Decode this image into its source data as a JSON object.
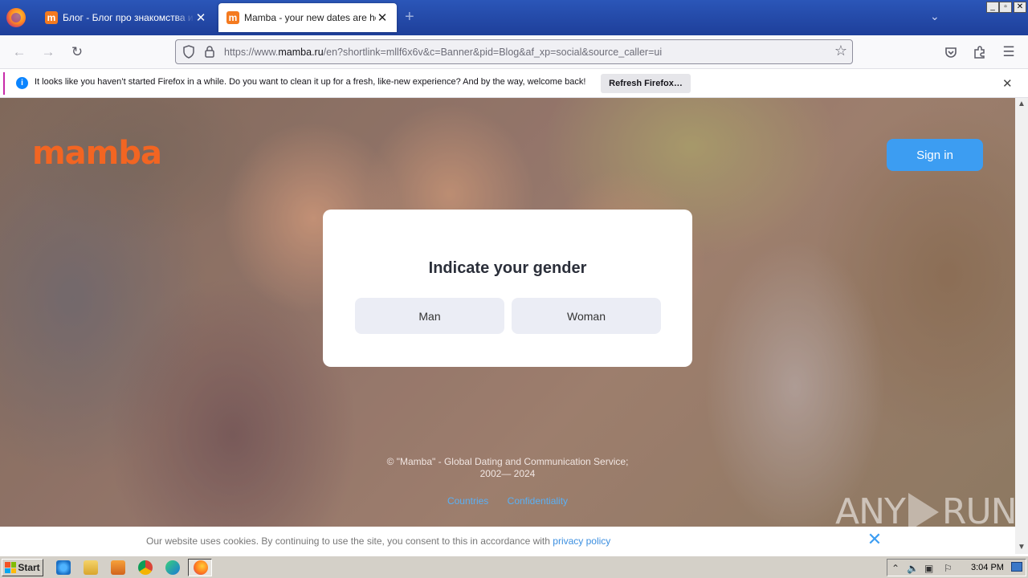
{
  "browser": {
    "tabs": [
      {
        "label": "Блог - Блог про знакомства и отношения",
        "active": false,
        "favicon": "m"
      },
      {
        "label": "Mamba - your new dates are here",
        "active": true,
        "favicon": "m"
      }
    ],
    "new_tab_symbol": "+",
    "tabs_list_symbol": "⌄",
    "window_buttons": {
      "minimize": "_",
      "maximize": "▫",
      "close": "✕"
    },
    "url": {
      "prefix": "https://www.",
      "host": "mamba.ru",
      "path": "/en?shortlink=mllf6x6v&c=Banner&pid=Blog&af_xp=social&source_caller=ui"
    },
    "notification": {
      "text": "It looks like you haven’t started Firefox in a while. Do you want to clean it up for a fresh, like-new experience? And by the way, welcome back!",
      "button": "Refresh Firefox…",
      "icon": "i"
    }
  },
  "page": {
    "logo": "mamba",
    "signin_label": "Sign in",
    "dialog": {
      "title": "Indicate your gender",
      "options": [
        "Man",
        "Woman"
      ]
    },
    "copyright_line1": "© \"Mamba\" - Global Dating and Communication Service;",
    "copyright_line2": "2002— 2024",
    "footer_links": [
      "Countries",
      "Confidentiality"
    ],
    "cookie": {
      "text": "Our website uses cookies. By continuing to use the site, you consent to this in accordance with ",
      "link": "privacy policy",
      "close": "✕"
    },
    "watermark": {
      "left": "ANY",
      "right": "RUN"
    }
  },
  "taskbar": {
    "start_label": "Start",
    "clock": "3:04 PM"
  },
  "colors": {
    "brand_orange": "#f26522",
    "signin_blue": "#3c9df2",
    "link_blue": "#5ab0f5"
  }
}
